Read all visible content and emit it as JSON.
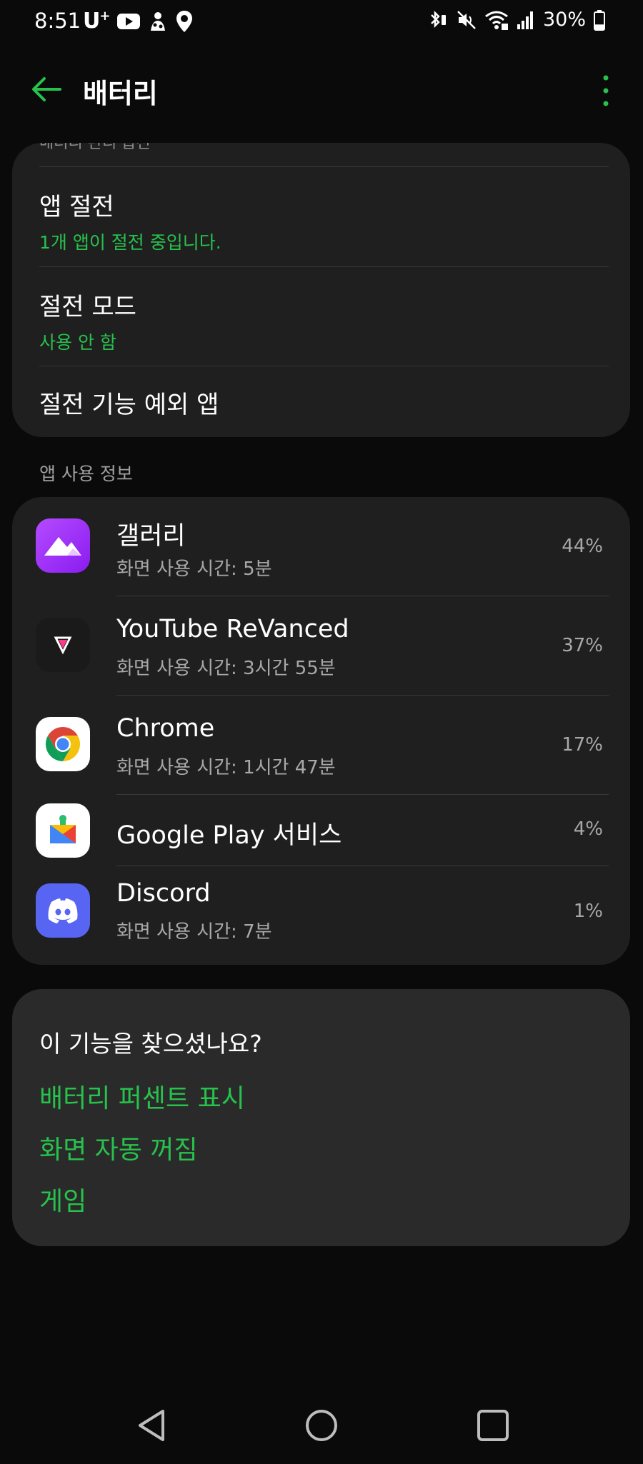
{
  "status_bar": {
    "time": "8:51",
    "carrier": "U",
    "carrier_sup": "+",
    "battery_percent": "30%",
    "battery_level": 0.3
  },
  "header": {
    "title": "배터리"
  },
  "power_card": {
    "cut_text": "배터리 관리 옵션",
    "app_saving": {
      "title": "앱 절전",
      "subtitle": "1개 앱이 절전 중입니다."
    },
    "power_saving_mode": {
      "title": "절전 모드",
      "subtitle": "사용 안 함"
    },
    "exceptions": {
      "title": "절전 기능 예외 앱"
    }
  },
  "app_usage": {
    "section_label": "앱 사용 정보",
    "apps": [
      {
        "name": "갤러리",
        "detail": "화면 사용 시간: 5분",
        "percent": "44%",
        "icon": "gallery-icon"
      },
      {
        "name": "YouTube ReVanced",
        "detail": "화면 사용 시간: 3시간 55분",
        "percent": "37%",
        "icon": "youtube-revanced-icon"
      },
      {
        "name": "Chrome",
        "detail": "화면 사용 시간: 1시간 47분",
        "percent": "17%",
        "icon": "chrome-icon"
      },
      {
        "name": "Google Play 서비스",
        "detail": "",
        "percent": "4%",
        "icon": "google-play-services-icon"
      },
      {
        "name": "Discord",
        "detail": "화면 사용 시간: 7분",
        "percent": "1%",
        "icon": "discord-icon"
      }
    ]
  },
  "suggestions": {
    "title": "이 기능을 찾으셨나요?",
    "links": [
      "배터리 퍼센트 표시",
      "화면 자동 꺼짐",
      "게임"
    ]
  },
  "colors": {
    "accent": "#27c24c",
    "background": "#0a0a0a",
    "card": "#1f1f1f"
  }
}
